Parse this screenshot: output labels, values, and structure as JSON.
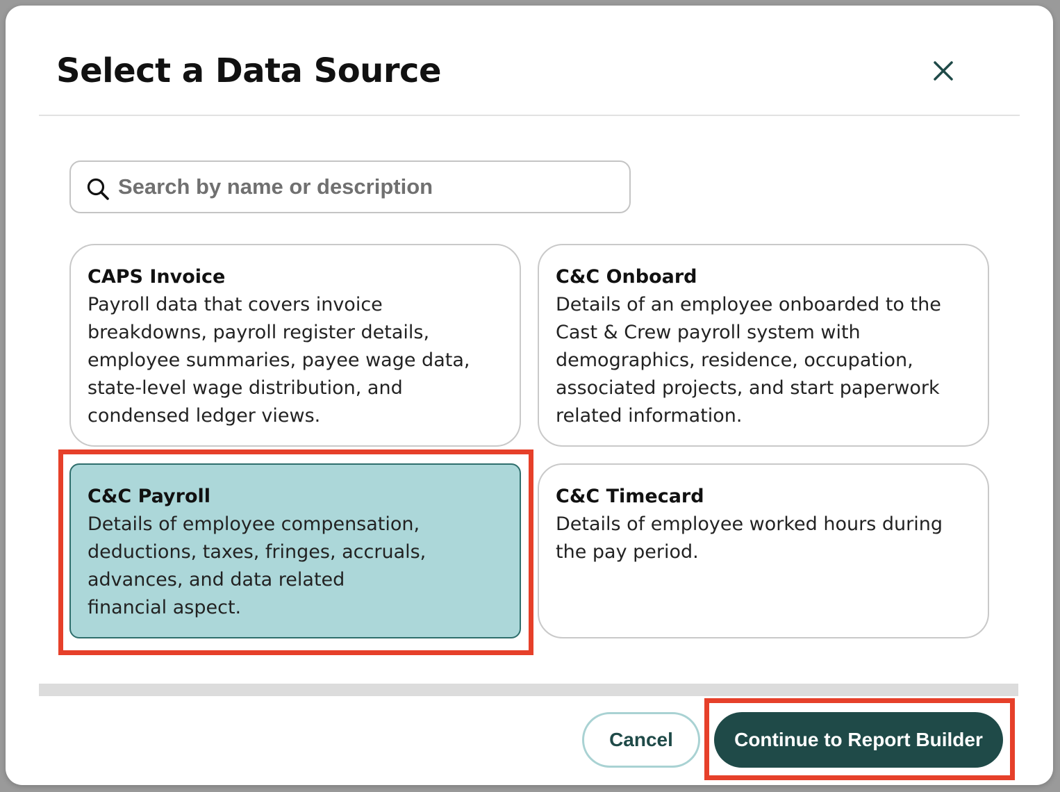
{
  "dialog": {
    "title": "Select a Data Source",
    "close_icon": "close-icon"
  },
  "search": {
    "placeholder": "Search by name or description",
    "value": "",
    "icon": "search-icon"
  },
  "sources": [
    {
      "title": "CAPS Invoice",
      "description": "Payroll data that covers invoice\nbreakdowns, payroll register details,\nemployee summaries, payee wage data,\nstate-level wage distribution, and\ncondensed ledger views.",
      "selected": false
    },
    {
      "title": "C&C Onboard",
      "description": "Details of an employee onboarded to the\nCast & Crew payroll system with\ndemographics, residence, occupation,\nassociated projects, and start paperwork\nrelated information.",
      "selected": false
    },
    {
      "title": "C&C Payroll",
      "description": "Details of employee compensation,\ndeductions, taxes, fringes, accruals,\nadvances, and data related\nfinancial aspect.",
      "selected": true
    },
    {
      "title": "C&C Timecard",
      "description": "Details of employee worked hours during\nthe pay period.",
      "selected": false
    }
  ],
  "footer": {
    "cancel_label": "Cancel",
    "continue_label": "Continue to Report Builder"
  },
  "colors": {
    "primary": "#1f4a48",
    "selected_card_bg": "#acd7d9",
    "highlight": "#e6402a"
  }
}
